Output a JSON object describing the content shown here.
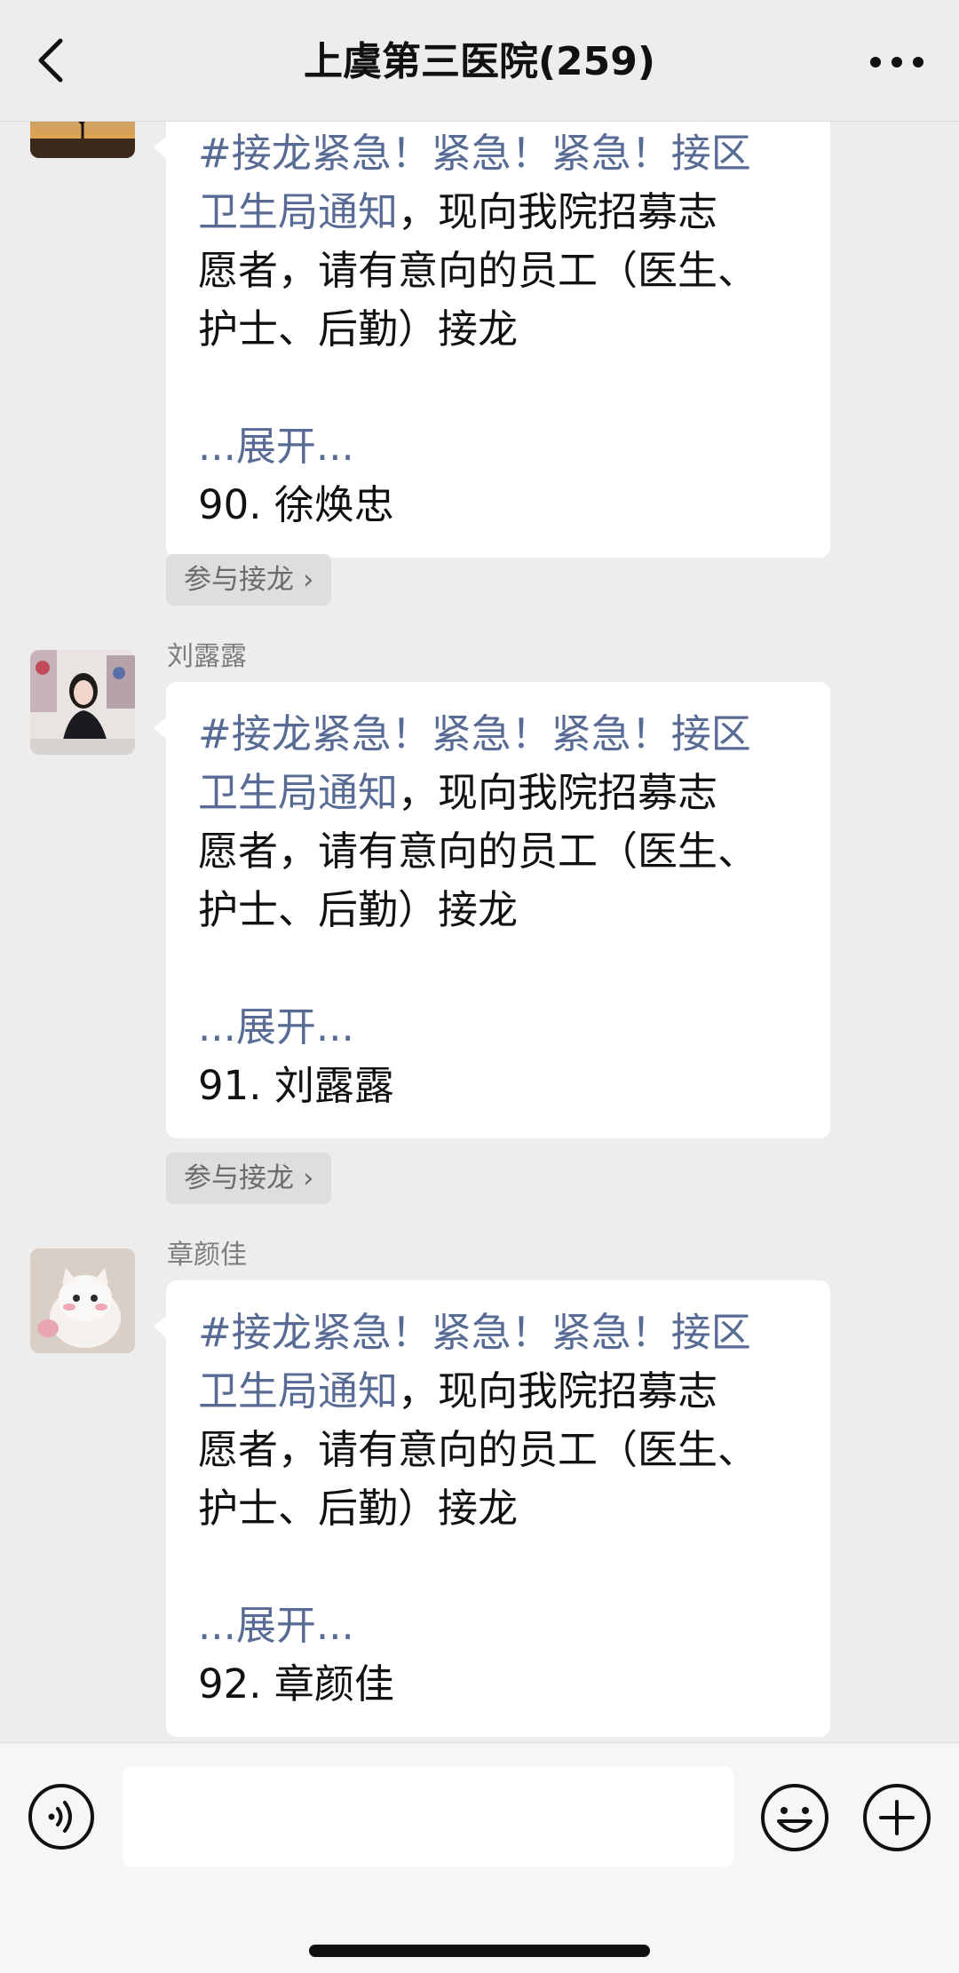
{
  "header": {
    "title": "上虞第三医院(259)",
    "back_icon": "chevron-left-icon",
    "more_icon": "more-dots-icon"
  },
  "messages": [
    {
      "sender": "",
      "line1_link": "#接龙紧急！紧急！紧急！接区",
      "line2_link": "卫生局通知",
      "line2_rest": "，现向我院招募志",
      "line3": "愿者，请有意向的员工（医生、",
      "line4": "护士、后勤）接龙",
      "expand": "...展开...",
      "entry": "90. 徐焕忠",
      "join": "参与接龙"
    },
    {
      "sender": "刘露露",
      "line1_link": "#接龙紧急！紧急！紧急！接区",
      "line2_link": "卫生局通知",
      "line2_rest": "，现向我院招募志",
      "line3": "愿者，请有意向的员工（医生、",
      "line4": "护士、后勤）接龙",
      "expand": "...展开...",
      "entry": "91. 刘露露",
      "join": "参与接龙"
    },
    {
      "sender": "章颜佳",
      "line1_link": "#接龙紧急！紧急！紧急！接区",
      "line2_link": "卫生局通知",
      "line2_rest": "，现向我院招募志",
      "line3": "愿者，请有意向的员工（医生、",
      "line4": "护士、后勤）接龙",
      "expand": "...展开...",
      "entry": "92. 章颜佳"
    }
  ],
  "join_chevron": "›",
  "input": {
    "value": "",
    "placeholder": ""
  },
  "colors": {
    "link": "#576b95",
    "background": "#ededed",
    "bubble": "#ffffff"
  }
}
